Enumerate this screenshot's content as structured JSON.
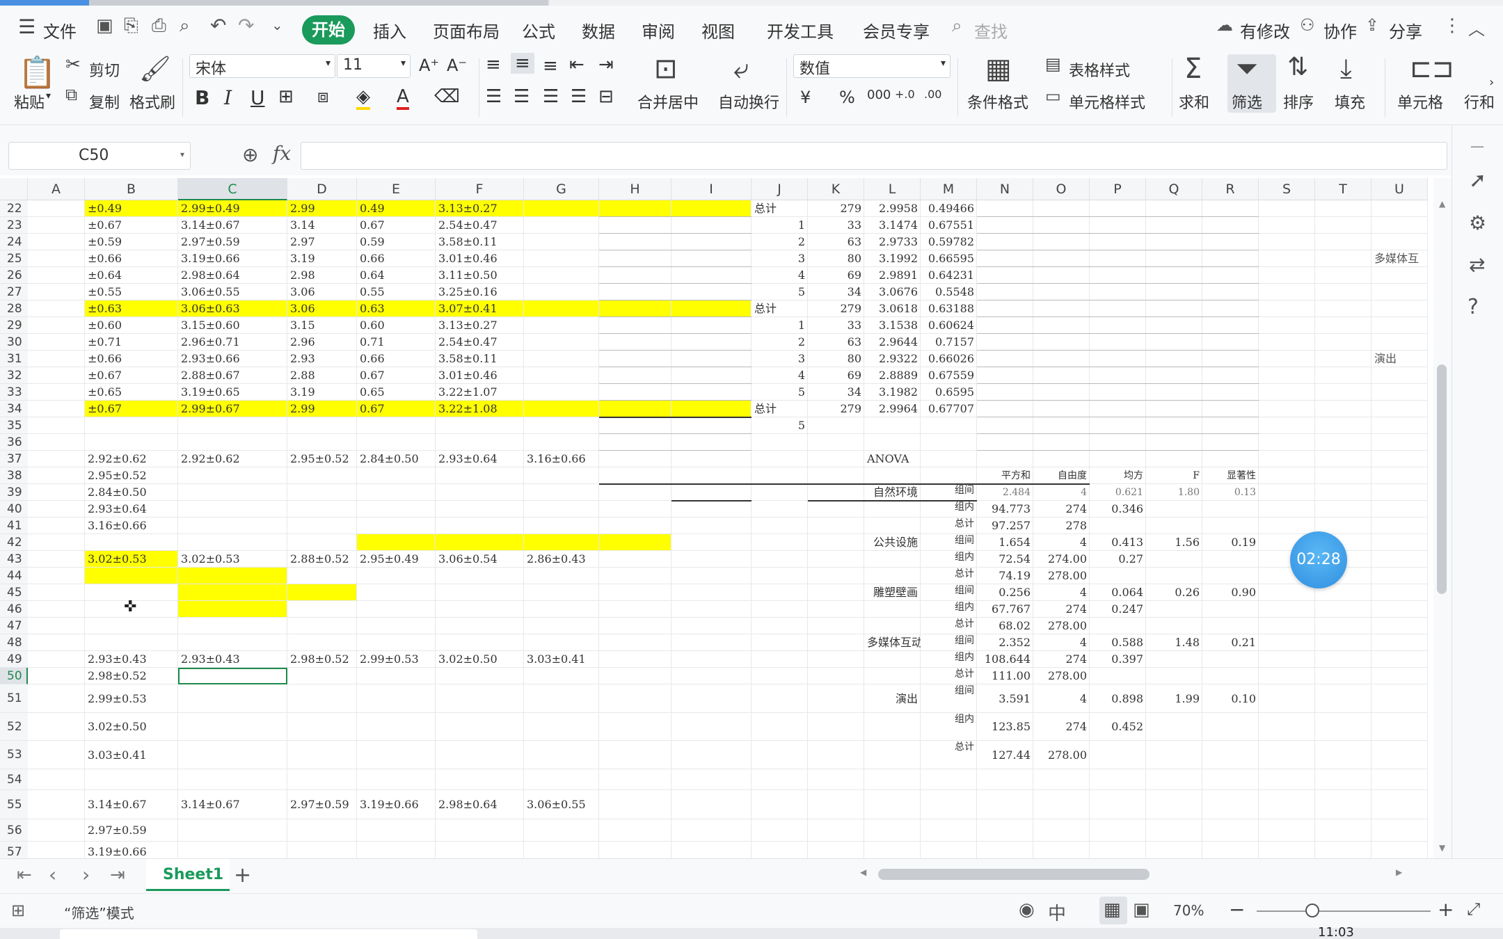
{
  "menu": {
    "file": "文件",
    "home": "开始",
    "insert": "插入",
    "page_layout": "页面布局",
    "formulas": "公式",
    "data": "数据",
    "review": "审阅",
    "view": "视图",
    "developer": "开发工具",
    "member": "会员专享",
    "search_placeholder": "查找",
    "modified": "有修改",
    "collab": "协作",
    "share": "分享"
  },
  "ribbon": {
    "paste": "粘贴",
    "cut": "剪切",
    "copy": "复制",
    "format_painter": "格式刷",
    "font_name": "宋体",
    "font_size": "11",
    "merge_center": "合并居中",
    "wrap_text": "自动换行",
    "number_format": "数值",
    "conditional_format": "条件格式",
    "table_style": "表格样式",
    "cell_style": "单元格样式",
    "sum": "求和",
    "filter": "筛选",
    "sort": "排序",
    "fill": "填充",
    "cell": "单元格",
    "rows_cols": "行和"
  },
  "formula_bar": {
    "name_box": "C50",
    "fx": "fx",
    "formula": ""
  },
  "columns": [
    "A",
    "B",
    "C",
    "D",
    "E",
    "F",
    "G",
    "H",
    "I",
    "J",
    "K",
    "L",
    "M",
    "N",
    "O",
    "P",
    "Q",
    "R",
    "S",
    "T",
    "U"
  ],
  "rows": [
    "22",
    "23",
    "24",
    "25",
    "26",
    "27",
    "28",
    "29",
    "30",
    "31",
    "32",
    "33",
    "34",
    "35",
    "36",
    "37",
    "38",
    "39",
    "40",
    "41",
    "42",
    "43",
    "44",
    "45",
    "46",
    "47",
    "48",
    "49",
    "50",
    "51",
    "52",
    "53",
    "54",
    "55",
    "56",
    "57"
  ],
  "cells": {
    "B22": "±0.49",
    "C22": "2.99±0.49",
    "D22": "2.99",
    "E22": "0.49",
    "F22": "3.13±0.27",
    "J22": "总计",
    "K22": "279",
    "L22": "2.9958",
    "M22": "0.49466",
    "B23": "±0.67",
    "C23": "3.14±0.67",
    "D23": "3.14",
    "E23": "0.67",
    "F23": "2.54±0.47",
    "J23": "1",
    "K23": "33",
    "L23": "3.1474",
    "M23": "0.67551",
    "B24": "±0.59",
    "C24": "2.97±0.59",
    "D24": "2.97",
    "E24": "0.59",
    "F24": "3.58±0.11",
    "J24": "2",
    "K24": "63",
    "L24": "2.9733",
    "M24": "0.59782",
    "B25": "±0.66",
    "C25": "3.19±0.66",
    "D25": "3.19",
    "E25": "0.66",
    "F25": "3.01±0.46",
    "J25": "3",
    "K25": "80",
    "L25": "3.1992",
    "M25": "0.66595",
    "U25": "多媒体互",
    "B26": "±0.64",
    "C26": "2.98±0.64",
    "D26": "2.98",
    "E26": "0.64",
    "F26": "3.11±0.50",
    "J26": "4",
    "K26": "69",
    "L26": "2.9891",
    "M26": "0.64231",
    "B27": "±0.55",
    "C27": "3.06±0.55",
    "D27": "3.06",
    "E27": "0.55",
    "F27": "3.25±0.16",
    "J27": "5",
    "K27": "34",
    "L27": "3.0676",
    "M27": "0.5548",
    "B28": "±0.63",
    "C28": "3.06±0.63",
    "D28": "3.06",
    "E28": "0.63",
    "F28": "3.07±0.41",
    "J28": "总计",
    "K28": "279",
    "L28": "3.0618",
    "M28": "0.63188",
    "B29": "±0.60",
    "C29": "3.15±0.60",
    "D29": "3.15",
    "E29": "0.60",
    "F29": "3.13±0.27",
    "J29": "1",
    "K29": "33",
    "L29": "3.1538",
    "M29": "0.60624",
    "B30": "±0.71",
    "C30": "2.96±0.71",
    "D30": "2.96",
    "E30": "0.71",
    "F30": "2.54±0.47",
    "J30": "2",
    "K30": "63",
    "L30": "2.9644",
    "M30": "0.7157",
    "B31": "±0.66",
    "C31": "2.93±0.66",
    "D31": "2.93",
    "E31": "0.66",
    "F31": "3.58±0.11",
    "J31": "3",
    "K31": "80",
    "L31": "2.9322",
    "M31": "0.66026",
    "U31": "演出",
    "B32": "±0.67",
    "C32": "2.88±0.67",
    "D32": "2.88",
    "E32": "0.67",
    "F32": "3.01±0.46",
    "J32": "4",
    "K32": "69",
    "L32": "2.8889",
    "M32": "0.67559",
    "B33": "±0.65",
    "C33": "3.19±0.65",
    "D33": "3.19",
    "E33": "0.65",
    "F33": "3.22±1.07",
    "J33": "5",
    "K33": "34",
    "L33": "3.1982",
    "M33": "0.6595",
    "B34": "±0.67",
    "C34": "2.99±0.67",
    "D34": "2.99",
    "E34": "0.67",
    "F34": "3.22±1.08",
    "J34": "总计",
    "K34": "279",
    "L34": "2.9964",
    "M34": "0.67707",
    "J35": "5",
    "B37": "2.92±0.62",
    "C37": "2.92±0.62",
    "D37": "2.95±0.52",
    "E37": "2.84±0.50",
    "F37": "2.93±0.64",
    "G37": "3.16±0.66",
    "L37": "ANOVA",
    "B38": "2.95±0.52",
    "N38": "平方和",
    "O38": "自由度",
    "P38": "均方",
    "Q38": "F",
    "R38": "显著性",
    "B39": "2.84±0.50",
    "L39": "自然环境",
    "M39": "组间",
    "N39": "2.484",
    "O39": "4",
    "P39": "0.621",
    "Q39": "1.80",
    "R39": "0.13",
    "B40": "2.93±0.64",
    "M40": "组内",
    "N40": "94.773",
    "O40": "274",
    "P40": "0.346",
    "B41": "3.16±0.66",
    "M41": "总计",
    "N41": "97.257",
    "O41": "278",
    "L42": "公共设施",
    "M42": "组间",
    "N42": "1.654",
    "O42": "4",
    "P42": "0.413",
    "Q42": "1.56",
    "R42": "0.19",
    "B43": "3.02±0.53",
    "C43": "3.02±0.53",
    "D43": "2.88±0.52",
    "E43": "2.95±0.49",
    "F43": "3.06±0.54",
    "G43": "2.86±0.43",
    "M43": "组内",
    "N43": "72.54",
    "O43": "274.00",
    "P43": "0.27",
    "M44": "总计",
    "N44": "74.19",
    "O44": "278.00",
    "L45": "雕塑壁画",
    "M45": "组间",
    "N45": "0.256",
    "O45": "4",
    "P45": "0.064",
    "Q45": "0.26",
    "R45": "0.90",
    "M46": "组内",
    "N46": "67.767",
    "O46": "274",
    "P46": "0.247",
    "M47": "总计",
    "N47": "68.02",
    "O47": "278.00",
    "L48": "多媒体互动",
    "M48": "组间",
    "N48": "2.352",
    "O48": "4",
    "P48": "0.588",
    "Q48": "1.48",
    "R48": "0.21",
    "B49": "2.93±0.43",
    "C49": "2.93±0.43",
    "D49": "2.98±0.52",
    "E49": "2.99±0.53",
    "F49": "3.02±0.50",
    "G49": "3.03±0.41",
    "M49": "组内",
    "N49": "108.644",
    "O49": "274",
    "P49": "0.397",
    "B50": "2.98±0.52",
    "M50": "总计",
    "N50": "111.00",
    "O50": "278.00",
    "B51": "2.99±0.53",
    "L51": "演出",
    "M51": "组间",
    "N51": "3.591",
    "O51": "4",
    "P51": "0.898",
    "Q51": "1.99",
    "R51": "0.10",
    "B52": "3.02±0.50",
    "M52": "组内",
    "N52": "123.85",
    "O52": "274",
    "P52": "0.452",
    "B53": "3.03±0.41",
    "M53": "总计",
    "N53": "127.44",
    "O53": "278.00",
    "B55": "3.14±0.67",
    "C55": "3.14±0.67",
    "D55": "2.97±0.59",
    "E55": "3.19±0.66",
    "F55": "2.98±0.64",
    "G55": "3.06±0.55",
    "B56": "2.97±0.59",
    "B57": "3.19±0.66"
  },
  "sheet_tabs": [
    "Sheet1"
  ],
  "status": {
    "mode": "“筛选”模式",
    "zoom": "70%"
  },
  "timer": "02:28",
  "taskbar_clock": "11:03",
  "colors": {
    "accent": "#1a9a5b",
    "highlight": "#ffff00",
    "selected_cell": "#1e8a4c"
  }
}
